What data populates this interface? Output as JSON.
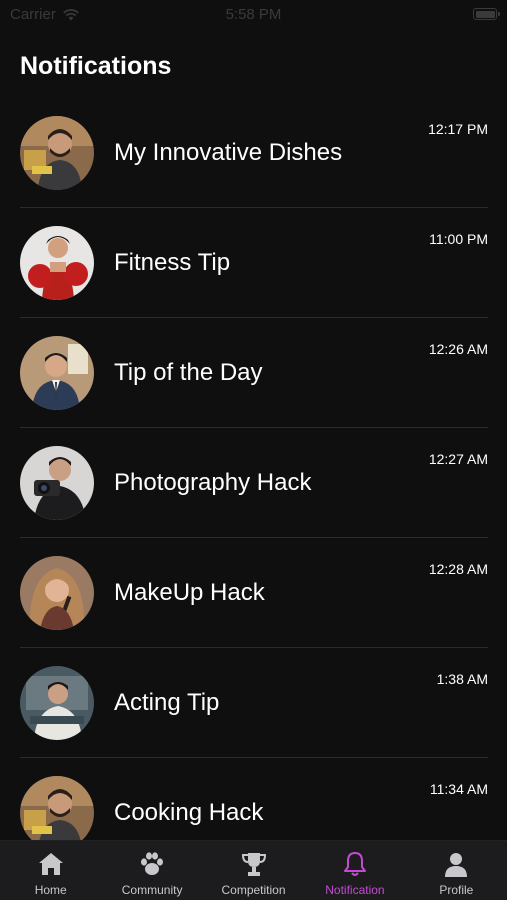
{
  "status_bar": {
    "carrier": "Carrier",
    "time": "5:58 PM"
  },
  "page": {
    "title": "Notifications"
  },
  "notifications": [
    {
      "title": "My Innovative Dishes",
      "time": "12:17 PM",
      "avatar": "chef-avatar"
    },
    {
      "title": "Fitness Tip",
      "time": "11:00 PM",
      "avatar": "boxer-avatar"
    },
    {
      "title": "Tip of the Day",
      "time": "12:26 AM",
      "avatar": "presenter-avatar"
    },
    {
      "title": "Photography Hack",
      "time": "12:27 AM",
      "avatar": "photographer-avatar"
    },
    {
      "title": "MakeUp Hack",
      "time": "12:28 AM",
      "avatar": "makeup-artist-avatar"
    },
    {
      "title": "Acting Tip",
      "time": "1:38 AM",
      "avatar": "actor-avatar"
    },
    {
      "title": "Cooking Hack",
      "time": "11:34 AM",
      "avatar": "chef-avatar"
    }
  ],
  "tab_bar": {
    "items": [
      {
        "label": "Home",
        "icon": "home-icon"
      },
      {
        "label": "Community",
        "icon": "paw-icon"
      },
      {
        "label": "Competition",
        "icon": "trophy-icon"
      },
      {
        "label": "Notification",
        "icon": "bell-icon",
        "active": true
      },
      {
        "label": "Profile",
        "icon": "person-icon"
      }
    ]
  },
  "colors": {
    "background": "#0f0f10",
    "tab_bar": "#1c1c1e",
    "accent": "#c44ad6",
    "divider": "#2b2b2d"
  }
}
